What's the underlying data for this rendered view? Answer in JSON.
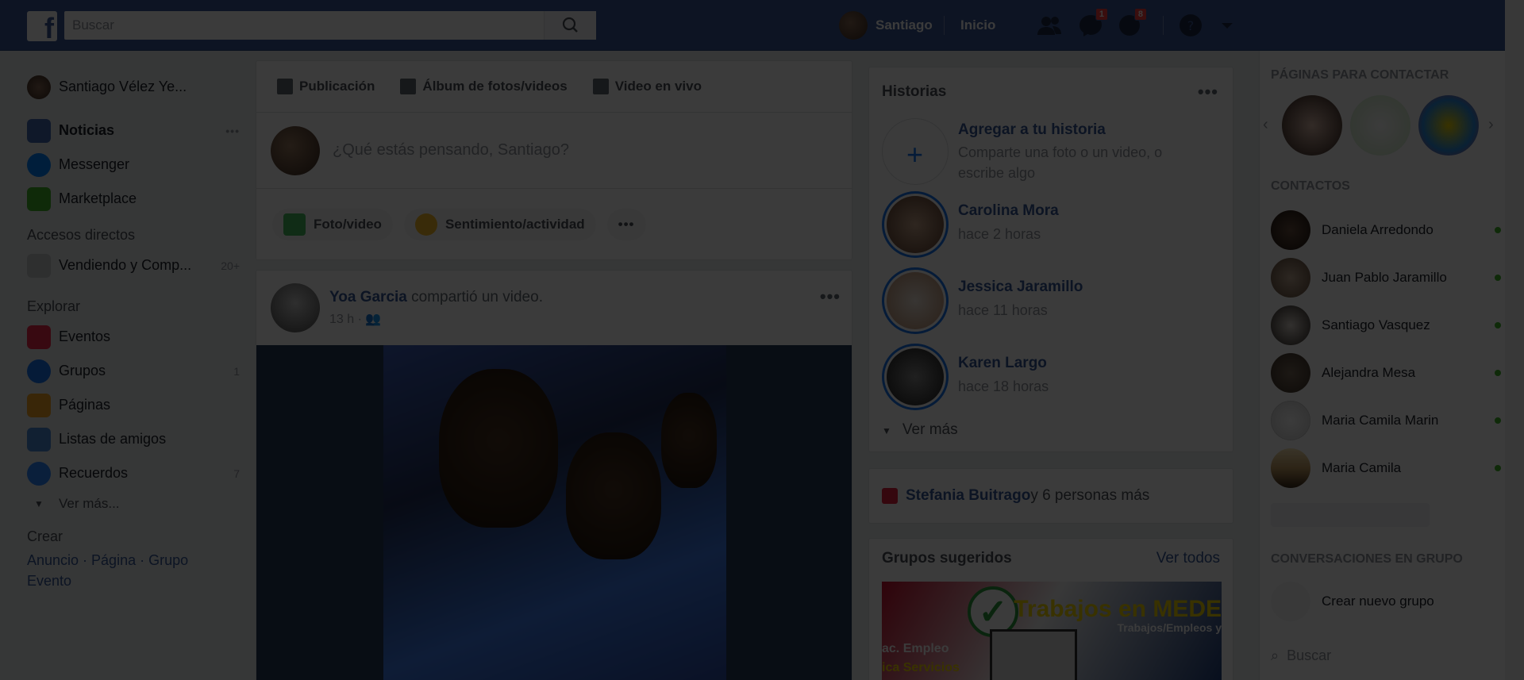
{
  "topbar": {
    "search_placeholder": "Buscar",
    "user_name": "Santiago",
    "home_label": "Inicio",
    "messages_badge": "1",
    "notifications_badge": "8"
  },
  "leftnav": {
    "profile_name": "Santiago Vélez Ye...",
    "items": [
      {
        "label": "Noticias",
        "more": "•••"
      },
      {
        "label": "Messenger"
      },
      {
        "label": "Marketplace"
      }
    ],
    "shortcuts_heading": "Accesos directos",
    "shortcuts": [
      {
        "label": "Vendiendo y Comp...",
        "count": "20+"
      }
    ],
    "explore_heading": "Explorar",
    "explore": [
      {
        "label": "Eventos",
        "count": ""
      },
      {
        "label": "Grupos",
        "count": "1"
      },
      {
        "label": "Páginas",
        "count": ""
      },
      {
        "label": "Listas de amigos",
        "count": ""
      },
      {
        "label": "Recuerdos",
        "count": "7"
      }
    ],
    "see_more": "Ver más...",
    "create_heading": "Crear",
    "create_line1": "Anuncio · Página · Grupo",
    "create_line2": "Evento"
  },
  "composer": {
    "tab_post": "Publicación",
    "tab_album": "Álbum de fotos/videos",
    "tab_live": "Video en vivo",
    "prompt": "¿Qué estás pensando, Santiago?",
    "action_photo": "Foto/video",
    "action_feeling": "Sentimiento/actividad",
    "action_more": "•••"
  },
  "post": {
    "author": "Yoa Garcia",
    "action": " compartió un video.",
    "time": "13 h ·",
    "more": "•••"
  },
  "stories": {
    "title": "Historias",
    "more": "•••",
    "add_title": "Agregar a tu historia",
    "add_desc": "Comparte una foto o un video, o escribe algo",
    "items": [
      {
        "name": "Carolina Mora",
        "time": "hace 2 horas"
      },
      {
        "name": "Jessica Jaramillo",
        "time": "hace 11 horas"
      },
      {
        "name": "Karen Largo",
        "time": "hace 18 horas"
      }
    ],
    "see_more": "Ver más"
  },
  "birthday": {
    "name": "Stefania Buitrago",
    "rest": " y 6 personas más"
  },
  "groups": {
    "title": "Grupos sugeridos",
    "see_all": "Ver todos",
    "banner": "Trabajos en MEDE",
    "banner_sub": "Trabajos/Empleos y",
    "left1": "ac. Empleo",
    "left2": "ica Servicios"
  },
  "chat": {
    "pages_heading": "PÁGINAS PARA CONTACTAR",
    "contacts_heading": "CONTACTOS",
    "contacts": [
      {
        "name": "Daniela Arredondo"
      },
      {
        "name": "Juan Pablo Jaramillo"
      },
      {
        "name": "Santiago Vasquez"
      },
      {
        "name": "Alejandra Mesa"
      },
      {
        "name": "Maria Camila Marin"
      },
      {
        "name": "Maria Camila"
      }
    ],
    "group_heading": "CONVERSACIONES EN GRUPO",
    "new_group": "Crear nuevo grupo",
    "search": "Buscar"
  },
  "colors": {
    "brand": "#3b5998",
    "link": "#365899",
    "online": "#42b72a",
    "badge": "#fa3e3e"
  }
}
